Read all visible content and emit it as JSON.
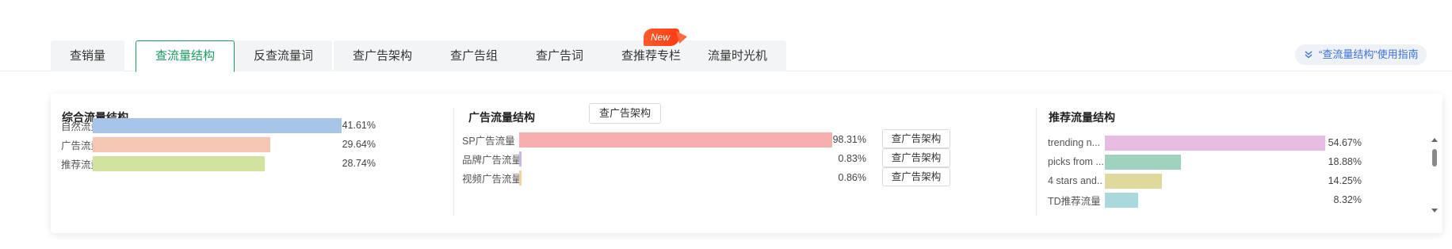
{
  "tabs": {
    "group1": [
      {
        "label": "查销量",
        "active": false
      }
    ],
    "group2": [
      {
        "label": "查流量结构",
        "active": true
      },
      {
        "label": "反查流量词",
        "active": false
      }
    ],
    "group3": [
      {
        "label": "查广告架构"
      },
      {
        "label": "查广告组"
      },
      {
        "label": "查广告词"
      },
      {
        "label": "查推荐专栏"
      }
    ],
    "group4": [
      {
        "label": "流量时光机"
      }
    ],
    "new_badge": "New"
  },
  "guide": {
    "label": "“查流量结构”使用指南",
    "icon": "double-chevron-down-icon"
  },
  "overall": {
    "title": "综合流量结构",
    "rows": [
      {
        "label": "自然流量",
        "value": 41.61,
        "pct": "41.61%",
        "color": "#a8c4e6"
      },
      {
        "label": "广告流量",
        "value": 29.64,
        "pct": "29.64%",
        "color": "#f5c6b4"
      },
      {
        "label": "推荐流量",
        "value": 28.74,
        "pct": "28.74%",
        "color": "#d2e29f"
      }
    ]
  },
  "ads": {
    "title": "广告流量结构",
    "button": "查广告架构",
    "rows": [
      {
        "label": "SP广告流量",
        "value": 98.31,
        "pct": "98.31%",
        "color": "#f6aeae",
        "button": "查广告架构"
      },
      {
        "label": "品牌广告流量",
        "value": 0.83,
        "pct": "0.83%",
        "color": "#c7b6e8",
        "button": "查广告架构"
      },
      {
        "label": "视频广告流量",
        "value": 0.86,
        "pct": "0.86%",
        "color": "#efd59a",
        "button": "查广告架构"
      }
    ]
  },
  "recommend": {
    "title": "推荐流量结构",
    "rows": [
      {
        "label": "trending n...",
        "value": 54.67,
        "pct": "54.67%",
        "color": "#e6bde0"
      },
      {
        "label": "picks from ...",
        "value": 18.88,
        "pct": "18.88%",
        "color": "#9fd3bd"
      },
      {
        "label": "4 stars and...",
        "value": 14.25,
        "pct": "14.25%",
        "color": "#ded99c"
      },
      {
        "label": "TD推荐流量",
        "value": 8.32,
        "pct": "8.32%",
        "color": "#a9d9dc"
      }
    ]
  }
}
